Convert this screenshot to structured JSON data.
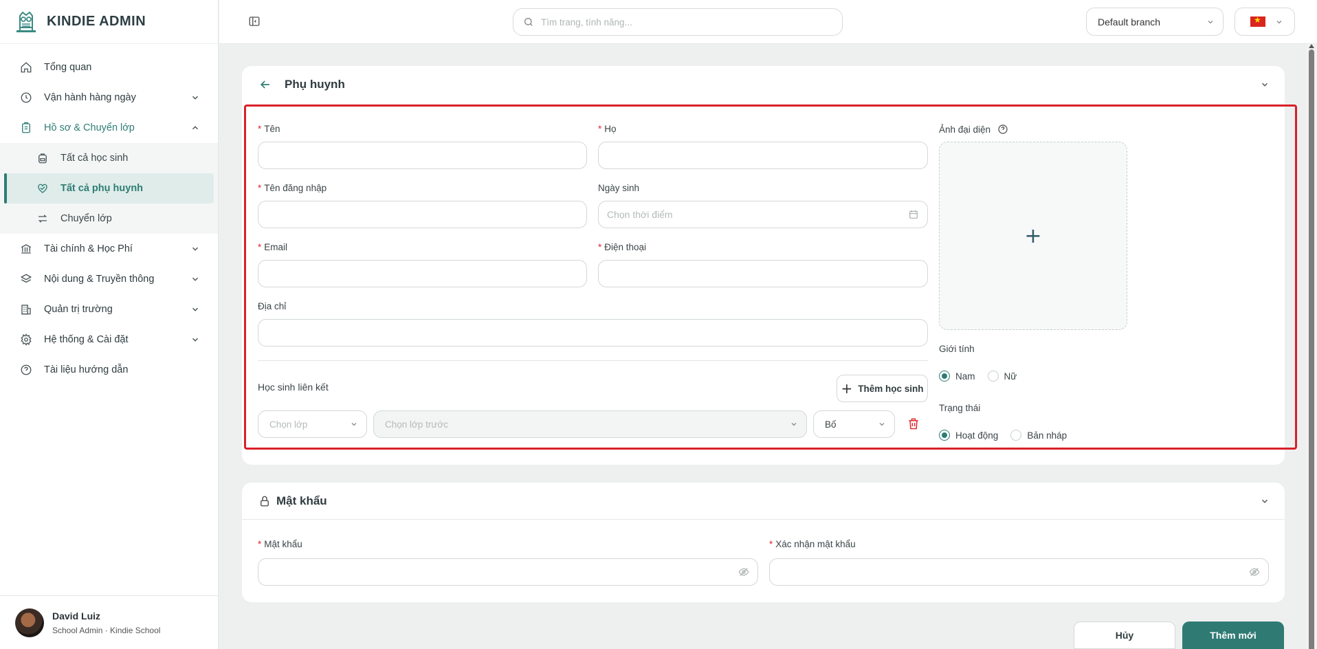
{
  "app": {
    "title": "KINDIE ADMIN"
  },
  "sidebar": {
    "items": [
      {
        "label": "Tổng quan",
        "icon": "home-icon"
      },
      {
        "label": "Vận hành hàng ngày",
        "icon": "clock-icon"
      },
      {
        "label": "Hồ sơ & Chuyển lớp",
        "icon": "clipboard-icon"
      },
      {
        "label": "Tài chính & Học Phí",
        "icon": "bank-icon"
      },
      {
        "label": "Nội dung & Truyền thông",
        "icon": "layers-icon"
      },
      {
        "label": "Quản trị trường",
        "icon": "building-icon"
      },
      {
        "label": "Hệ thống & Cài đặt",
        "icon": "gear-icon"
      },
      {
        "label": "Tài liệu hướng dẫn",
        "icon": "help-circle-icon"
      }
    ],
    "subitems": [
      {
        "label": "Tất cả học sinh",
        "icon": "backpack-icon"
      },
      {
        "label": "Tất cả phụ huynh",
        "icon": "heart-hand-icon"
      },
      {
        "label": "Chuyển lớp",
        "icon": "swap-icon"
      }
    ]
  },
  "user": {
    "name": "David Luiz",
    "role": "School Admin · Kindie School"
  },
  "topbar": {
    "search_placeholder": "Tìm trang, tính năng...",
    "branch": "Default branch"
  },
  "parent_card": {
    "title": "Phụ huynh",
    "first_name": {
      "label": "Tên",
      "value": ""
    },
    "last_name": {
      "label": "Họ",
      "value": ""
    },
    "username": {
      "label": "Tên đăng nhập",
      "value": ""
    },
    "birthday": {
      "label": "Ngày sinh",
      "placeholder": "Chọn thời điểm"
    },
    "email": {
      "label": "Email",
      "value": ""
    },
    "phone": {
      "label": "Điện thoại",
      "value": ""
    },
    "address": {
      "label": "Địa chỉ",
      "value": ""
    },
    "avatar_label": "Ảnh đại diện",
    "gender": {
      "label": "Giới tính",
      "options": [
        "Nam",
        "Nữ"
      ],
      "selected": "Nam"
    },
    "status": {
      "label": "Trạng thái",
      "options": [
        "Hoạt động",
        "Bản nháp"
      ],
      "selected": "Hoạt động"
    },
    "linked_students": {
      "label": "Học sinh liên kết",
      "add_button": "Thêm học sinh",
      "class_placeholder": "Chọn lớp",
      "student_placeholder": "Chọn lớp trước",
      "relation": "Bố"
    }
  },
  "password_card": {
    "title": "Mật khẩu",
    "password": {
      "label": "Mật khẩu"
    },
    "confirm": {
      "label": "Xác nhận mật khẩu"
    }
  },
  "actions": {
    "cancel": "Hủy",
    "create": "Thêm mới"
  },
  "colors": {
    "accent": "#2e7d74",
    "required": "#e0282f",
    "highlight": "#d8202a"
  }
}
